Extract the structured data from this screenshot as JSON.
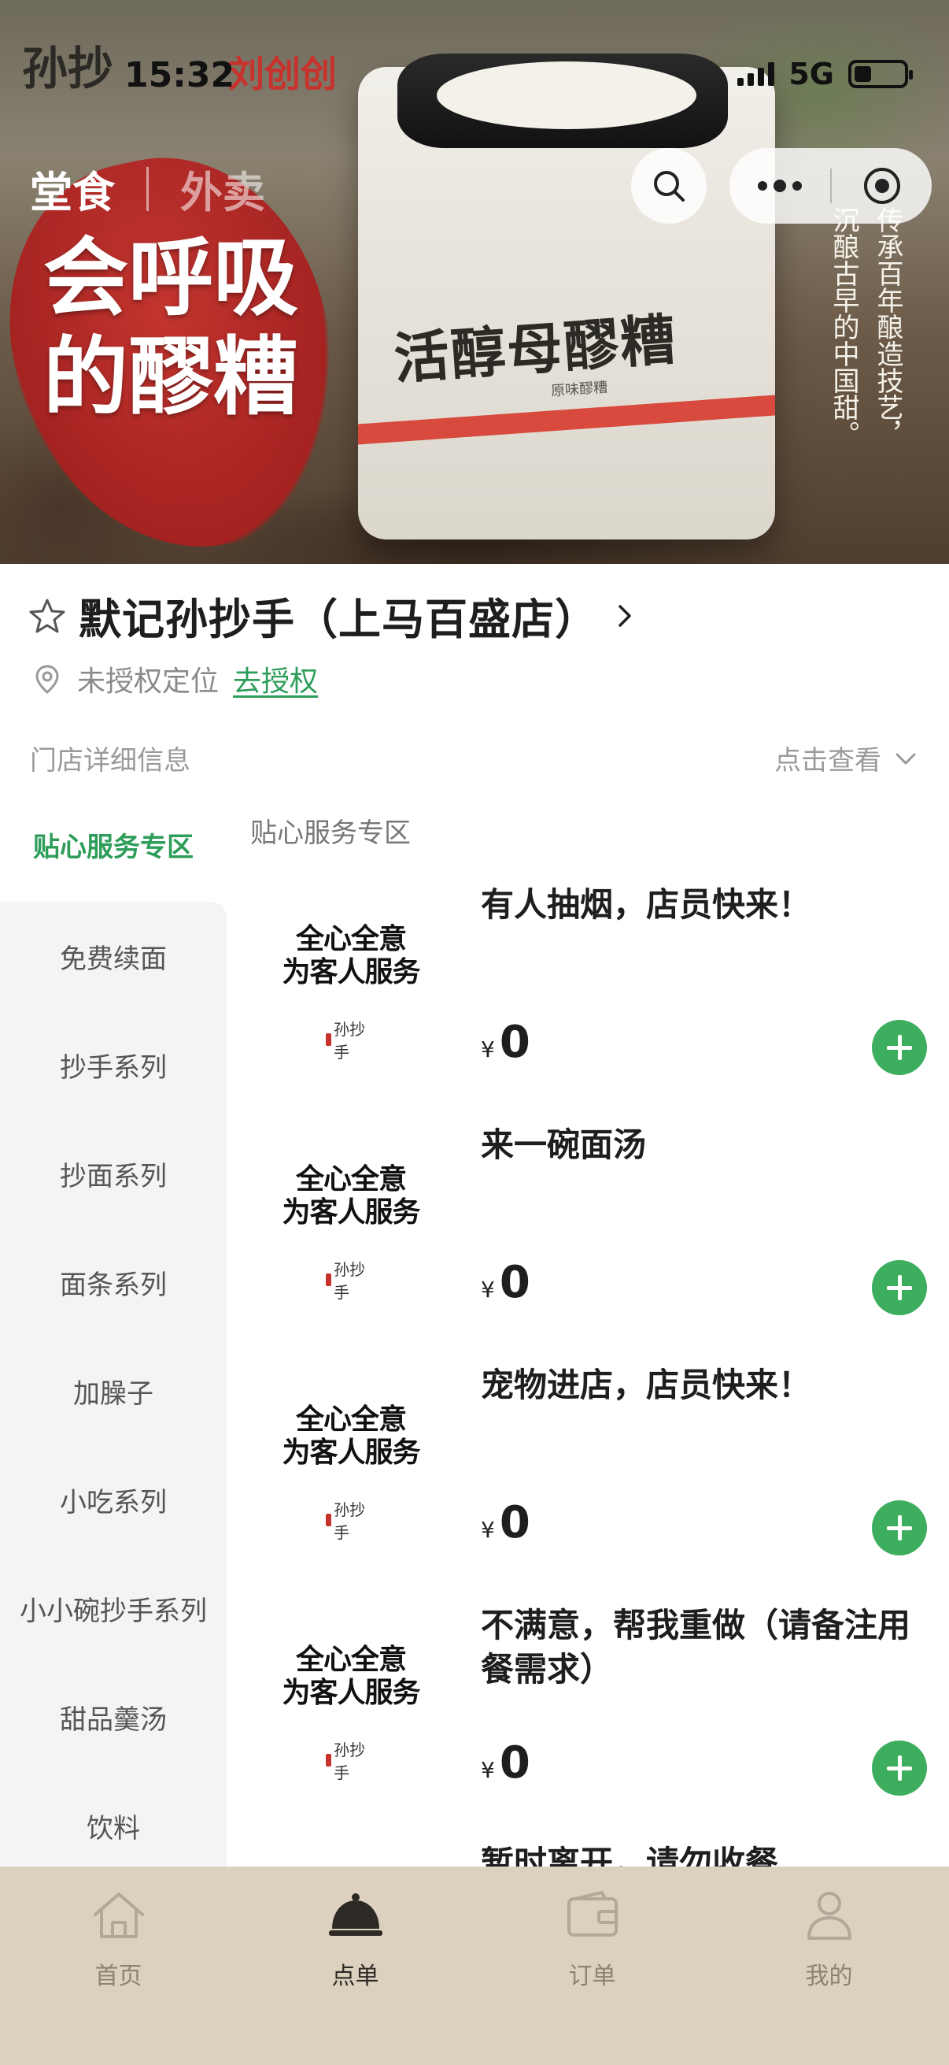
{
  "status_bar": {
    "time": "15:32",
    "network": "5G"
  },
  "banner": {
    "brand_left": "孙抄",
    "brand_right": "刘创创",
    "slogan_line1": "会呼吸",
    "slogan_line2": "的醪糟",
    "product_name": "活醇母醪糟",
    "product_sub": "原味醪糟",
    "vertical_col1": "传承百年酿造技艺，",
    "vertical_col2": "沉酿古早的中国甜。"
  },
  "mode_tabs": {
    "dine_in": "堂食",
    "takeout": "外卖"
  },
  "store": {
    "name": "默记孙抄手（上马百盛店）",
    "location_text": "未授权定位",
    "auth_link": "去授权",
    "detail_label": "门店详细信息",
    "detail_action": "点击查看"
  },
  "sidebar": {
    "active": "贴心服务专区",
    "items": [
      "免费续面",
      "抄手系列",
      "抄面系列",
      "面条系列",
      "加臊子",
      "小吃系列",
      "小小碗抄手系列",
      "甜品羹汤",
      "饮料"
    ]
  },
  "content": {
    "section_title": "贴心服务专区",
    "image_slogan_line1": "全心全意",
    "image_slogan_line2": "为客人服务",
    "image_logo": "孙抄手",
    "items": [
      {
        "name": "有人抽烟，店员快来！",
        "currency": "¥",
        "price": "0"
      },
      {
        "name": "来一碗面汤",
        "currency": "¥",
        "price": "0"
      },
      {
        "name": "宠物进店，店员快来！",
        "currency": "¥",
        "price": "0"
      },
      {
        "name": "不满意，帮我重做（请备注用餐需求）",
        "currency": "¥",
        "price": "0"
      }
    ],
    "partial_item": "暂时离开，请勿收餐"
  },
  "bottom_nav": {
    "items": [
      {
        "label": "首页",
        "icon": "home-icon"
      },
      {
        "label": "点单",
        "icon": "cloche-icon"
      },
      {
        "label": "订单",
        "icon": "wallet-icon"
      },
      {
        "label": "我的",
        "icon": "user-icon"
      }
    ],
    "active_index": 1
  },
  "colors": {
    "accent_green": "#2e9d5a",
    "add_button": "#3cae5e",
    "nav_bg": "#dcd0bf",
    "banner_red": "#c7322d"
  }
}
